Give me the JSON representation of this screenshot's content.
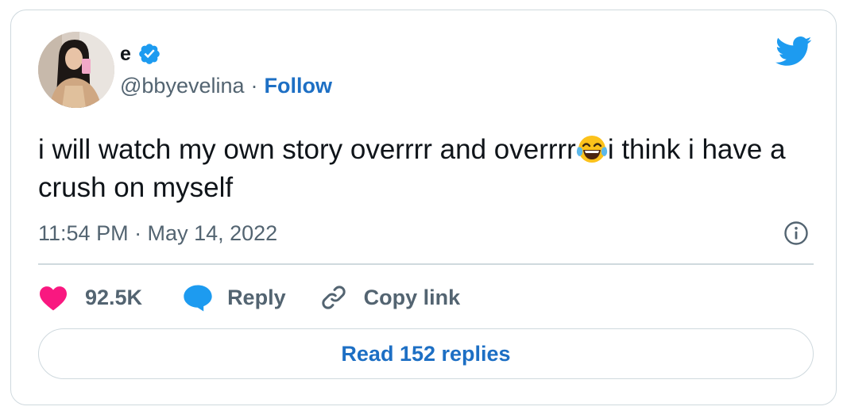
{
  "tweet": {
    "display_name": "e",
    "verified": true,
    "handle": "@bbyevelina",
    "separator": "·",
    "follow_label": "Follow",
    "text_part1": "i will watch my own story overrrr and overrrr",
    "emoji": "😂",
    "text_part2": "i think i have a crush on myself",
    "timestamp": "11:54 PM · May 14, 2022",
    "like_count": "92.5K",
    "reply_label": "Reply",
    "copy_link_label": "Copy link",
    "read_replies_label": "Read 152 replies"
  },
  "icons": {
    "platform_logo": "twitter-bird-icon",
    "verified_badge": "verified-badge-icon",
    "info": "info-icon",
    "like": "heart-icon",
    "reply": "speech-bubble-icon",
    "copy_link": "link-icon",
    "emoji": "face-with-tears-of-joy-emoji"
  },
  "colors": {
    "link_blue": "#1d6fc4",
    "twitter_blue": "#1d9bf0",
    "heart_pink": "#f91880",
    "muted_text": "#536471",
    "primary_text": "#0f1419",
    "border": "#cfd9de"
  }
}
